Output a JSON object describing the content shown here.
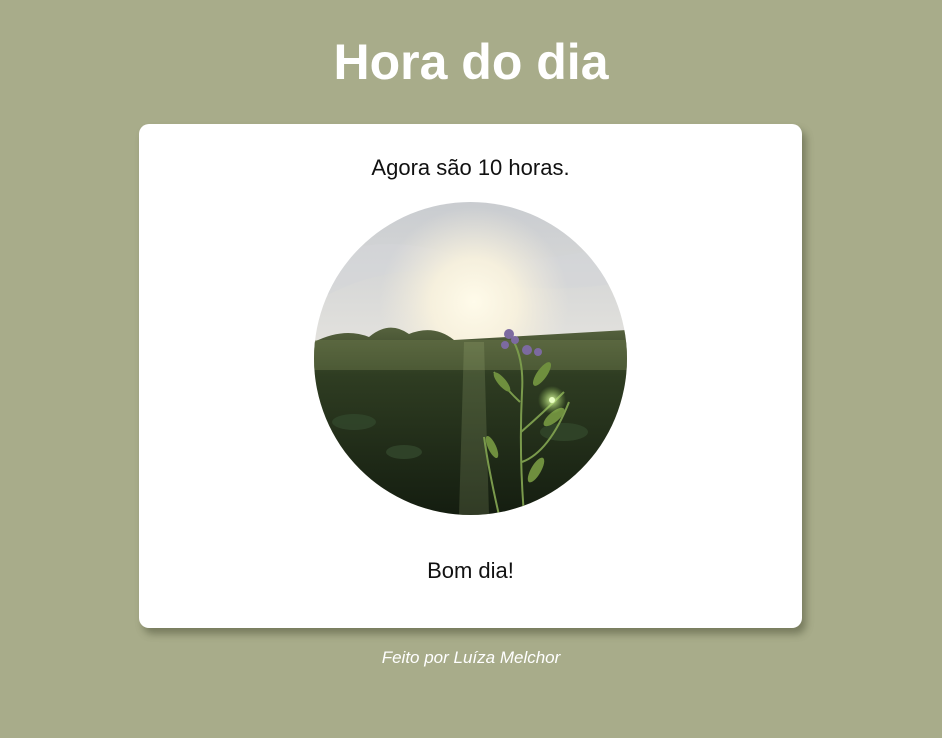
{
  "page": {
    "title": "Hora do dia",
    "background_color": "#a8ac8a"
  },
  "card": {
    "time_message": "Agora são 10 horas.",
    "image": "morning-field-photo",
    "greeting": "Bom dia!"
  },
  "footer": {
    "credit": "Feito por Luíza Melchor"
  }
}
